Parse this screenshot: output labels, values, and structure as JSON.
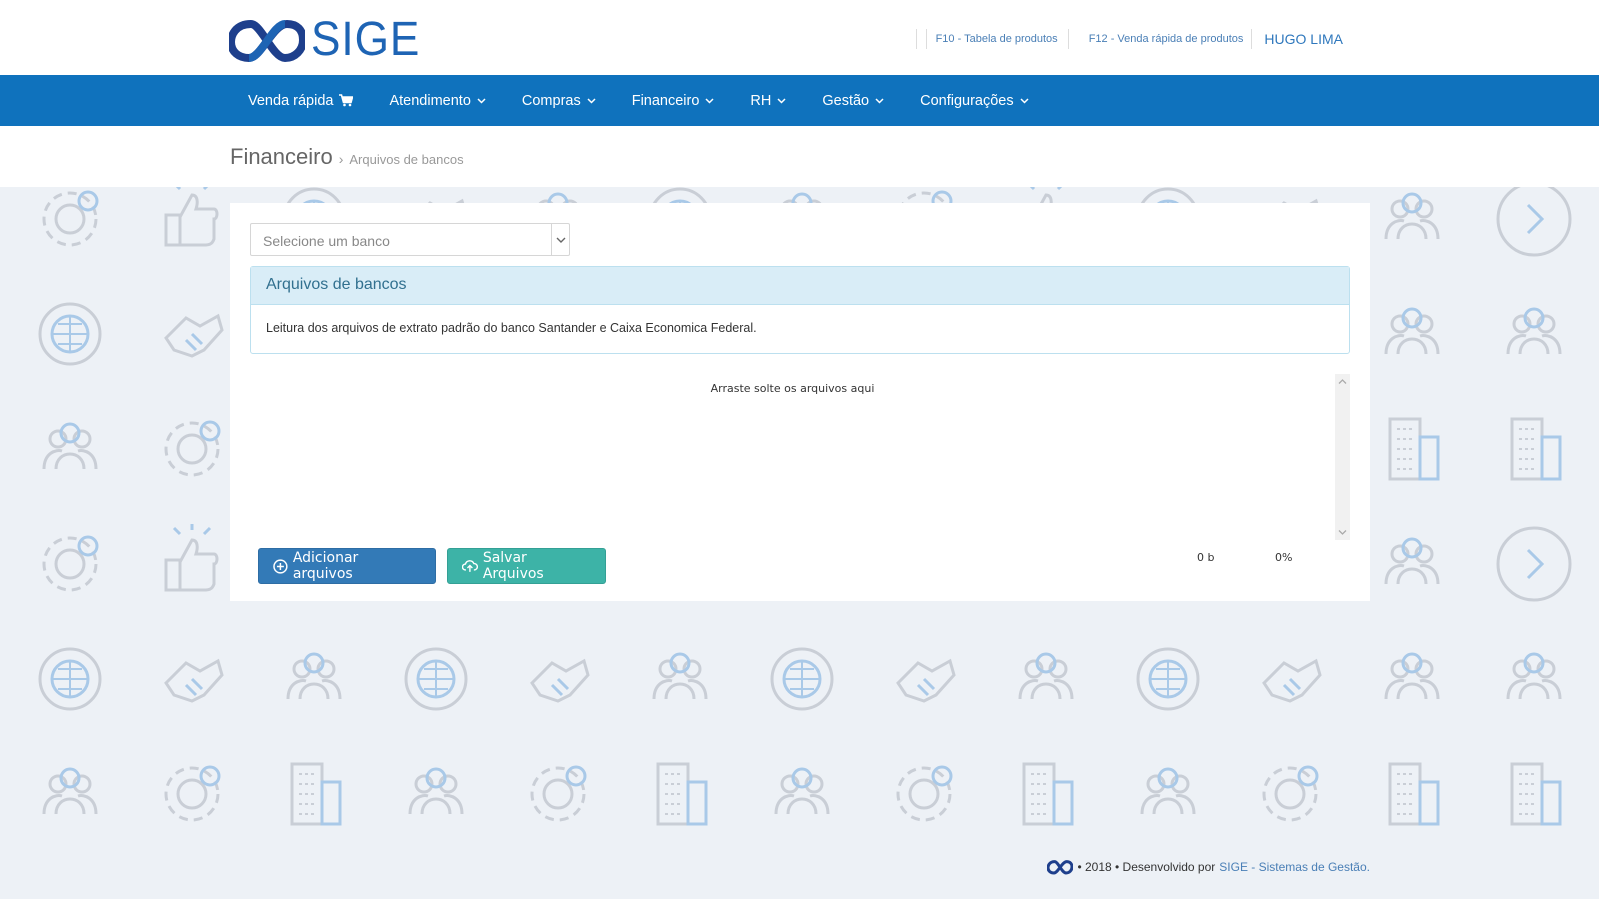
{
  "brand": {
    "name": "SIGE",
    "color": "#1e64b4"
  },
  "top_links": {
    "f10": "F10 - Tabela de produtos",
    "f12": "F12 - Venda rápida de produtos",
    "user": "HUGO LIMA"
  },
  "nav": {
    "color": "#0f72bd",
    "items": [
      {
        "label": "Venda rápida",
        "icon": "cart-icon"
      },
      {
        "label": "Atendimento",
        "icon": "chevron-down-icon"
      },
      {
        "label": "Compras",
        "icon": "chevron-down-icon"
      },
      {
        "label": "Financeiro",
        "icon": "chevron-down-icon"
      },
      {
        "label": "RH",
        "icon": "chevron-down-icon"
      },
      {
        "label": "Gestão",
        "icon": "chevron-down-icon"
      },
      {
        "label": "Configurações",
        "icon": "chevron-down-icon"
      }
    ]
  },
  "breadcrumb": {
    "title": "Financeiro",
    "separator": "›",
    "current": "Arquivos de bancos"
  },
  "bank_select": {
    "placeholder": "Selecione um banco"
  },
  "info": {
    "heading": "Arquivos de bancos",
    "body": "Leitura dos arquivos de extrato padrão do banco Santander e Caixa Economica Federal."
  },
  "dropzone": {
    "text": "Arraste solte os arquivos aqui"
  },
  "buttons": {
    "add": {
      "label": "Adicionar arquivos",
      "icon": "plus-circle-icon",
      "color": "#337ab7"
    },
    "save": {
      "label": "Salvar Arquivos",
      "icon": "cloud-upload-icon",
      "color": "#3db3a7"
    }
  },
  "upload_stats": {
    "size": "0 b",
    "percent": "0%"
  },
  "footer": {
    "text": "• 2018 • Desenvolvido por",
    "link": "SIGE - Sistemas de Gestão."
  }
}
